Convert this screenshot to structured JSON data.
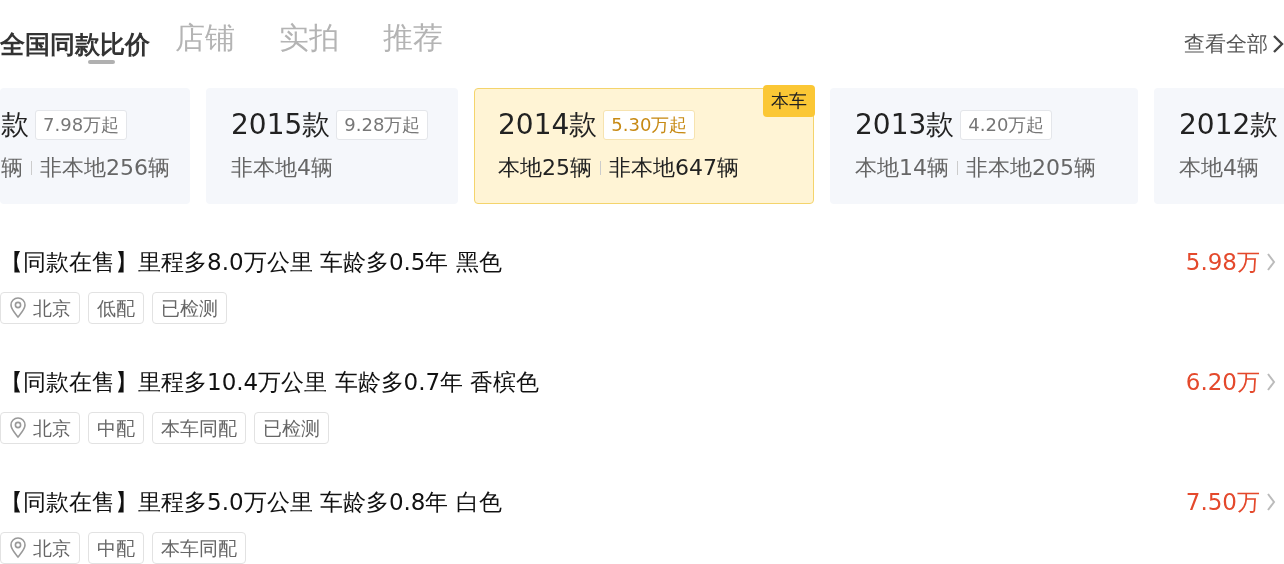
{
  "tabs": [
    {
      "label": "店铺",
      "selected": false
    },
    {
      "label": "实拍",
      "selected": false
    },
    {
      "label": "推荐",
      "selected": false
    }
  ],
  "section": {
    "title": "全国同款比价",
    "link": "查看全部"
  },
  "cards": [
    {
      "year": "款",
      "price": "7.98万起",
      "local": "辆",
      "nonlocal": "非本地256辆",
      "selected": false
    },
    {
      "year": "2015款",
      "price": "9.28万起",
      "nonlocal": "非本地4辆",
      "selected": false
    },
    {
      "year": "2014款",
      "price": "5.30万起",
      "local": "本地25辆",
      "nonlocal": "非本地647辆",
      "selected": true,
      "badge": "本车"
    },
    {
      "year": "2013款",
      "price": "4.20万起",
      "local": "本地14辆",
      "nonlocal": "非本地205辆",
      "selected": false
    },
    {
      "year": "2012款",
      "local": "本地4辆",
      "selected": false
    }
  ],
  "listings": [
    {
      "title": "【同款在售】里程多8.0万公里 车龄多0.5年 黑色",
      "price": "5.98万",
      "location": "北京",
      "tags": [
        "低配",
        "已检测"
      ]
    },
    {
      "title": "【同款在售】里程多10.4万公里 车龄多0.7年 香槟色",
      "price": "6.20万",
      "location": "北京",
      "tags": [
        "中配",
        "本车同配",
        "已检测"
      ]
    },
    {
      "title": "【同款在售】里程多5.0万公里 车龄多0.8年 白色",
      "price": "7.50万",
      "location": "北京",
      "tags": [
        "中配",
        "本车同配"
      ]
    }
  ]
}
